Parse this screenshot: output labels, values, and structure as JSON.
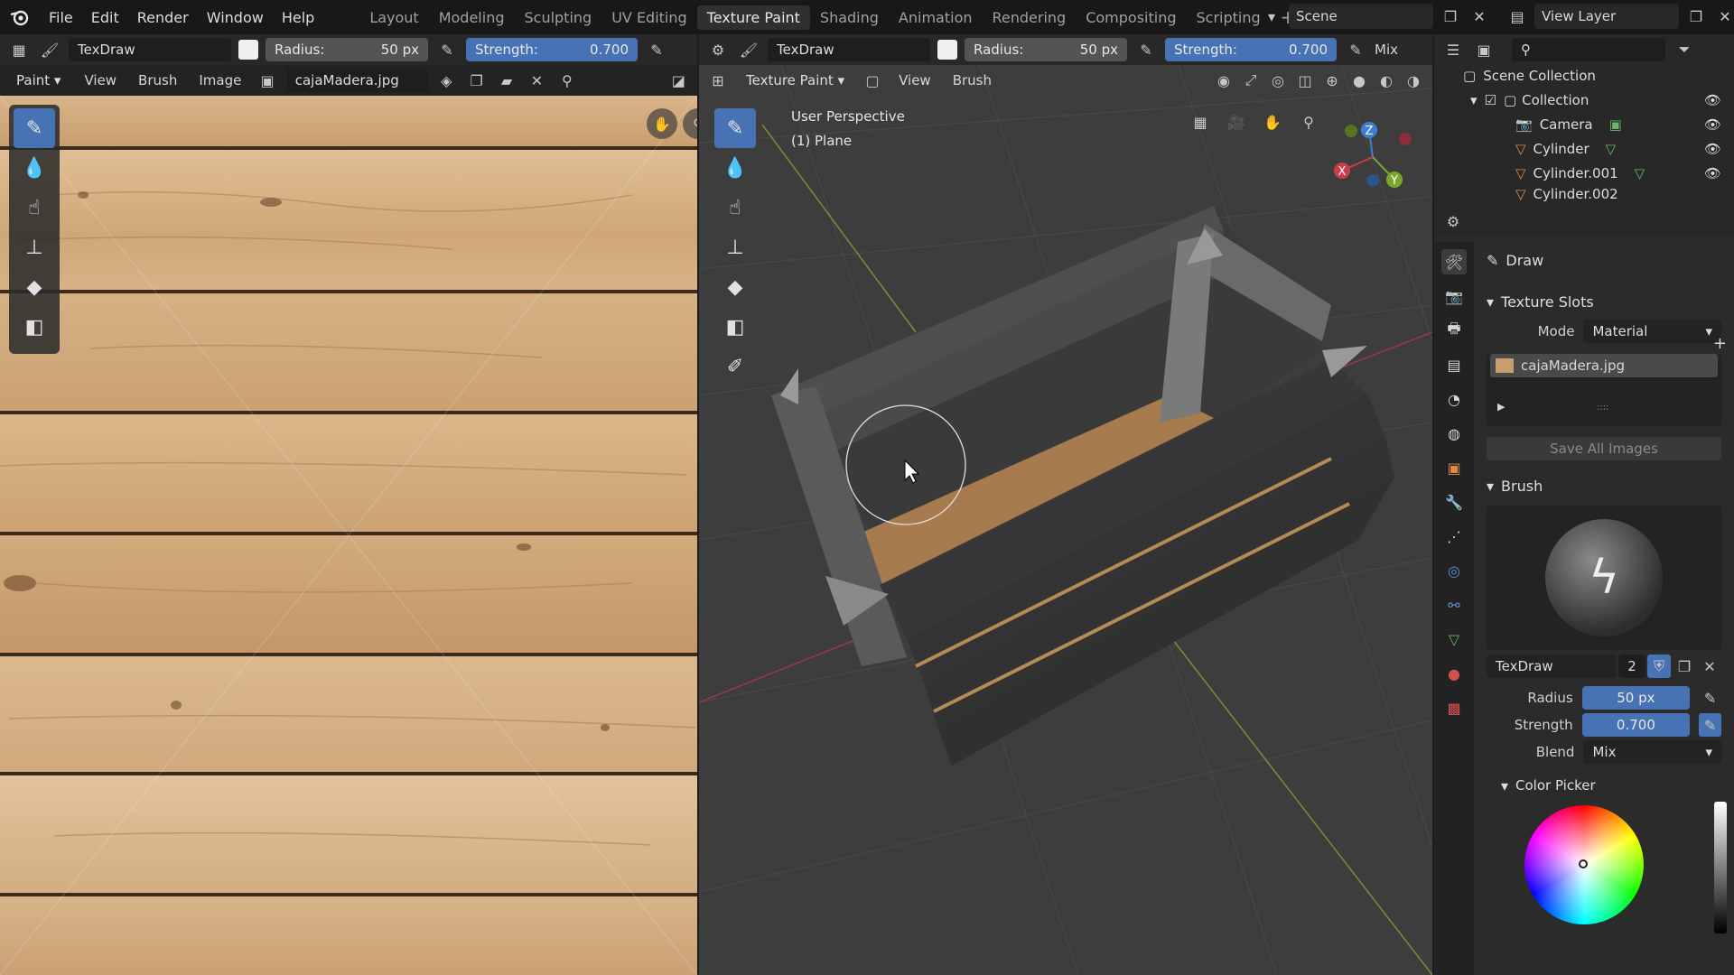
{
  "menu": {
    "file": "File",
    "edit": "Edit",
    "render": "Render",
    "window": "Window",
    "help": "Help"
  },
  "workspaces": [
    "Layout",
    "Modeling",
    "Sculpting",
    "UV Editing",
    "Texture Paint",
    "Shading",
    "Animation",
    "Rendering",
    "Compositing",
    "Scripting"
  ],
  "scene": {
    "name": "Scene",
    "view_layer": "View Layer"
  },
  "image_editor": {
    "brush_name": "TexDraw",
    "radius_label": "Radius:",
    "radius_value": "50 px",
    "strength_label": "Strength:",
    "strength_value": "0.700",
    "mode": "Paint",
    "view": "View",
    "brush": "Brush",
    "image": "Image",
    "image_name": "cajaMadera.jpg",
    "strength_fraction": 0.7
  },
  "viewport": {
    "brush_name": "TexDraw",
    "radius_label": "Radius:",
    "radius_value": "50 px",
    "strength_label": "Strength:",
    "strength_value": "0.700",
    "blend_short": "Mix",
    "mode": "Texture Paint",
    "view": "View",
    "brush": "Brush",
    "perspective": "User Perspective",
    "object": "(1) Plane",
    "axis_x": "X",
    "axis_y": "Y",
    "axis_z": "Z"
  },
  "outliner": {
    "root": "Scene Collection",
    "collection": "Collection",
    "items": [
      "Camera",
      "Cylinder",
      "Cylinder.001",
      "Cylinder.002"
    ]
  },
  "properties": {
    "tool": "Draw",
    "texture_slots": "Texture Slots",
    "mode_label": "Mode",
    "mode_value": "Material",
    "slot": "cajaMadera.jpg",
    "save_all": "Save All Images",
    "brush_section": "Brush",
    "brush_name": "TexDraw",
    "brush_users": "2",
    "radius_label": "Radius",
    "radius_value": "50 px",
    "strength_label": "Strength",
    "strength_value": "0.700",
    "blend_label": "Blend",
    "blend_value": "Mix",
    "color_picker": "Color Picker"
  },
  "colors": {
    "accent": "#4772b3",
    "header": "#181818",
    "panel": "#2b2b2b",
    "viewport": "#3d3d3d"
  }
}
